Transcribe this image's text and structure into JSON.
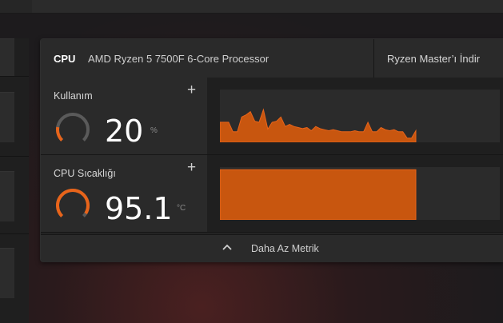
{
  "header": {
    "section": "CPU",
    "processor_name": "AMD Ryzen 5 7500F 6-Core Processor",
    "download_link": "Ryzen Master’ı İndir"
  },
  "metrics": [
    {
      "title": "Kullanım",
      "value": "20",
      "unit": "%",
      "gauge_fraction": 0.2,
      "add_label": "+",
      "history": [
        38,
        38,
        38,
        20,
        20,
        48,
        52,
        58,
        40,
        38,
        62,
        25,
        38,
        40,
        48,
        30,
        34,
        30,
        28,
        26,
        28,
        22,
        30,
        26,
        24,
        22,
        24,
        22,
        20,
        20,
        20,
        22,
        20,
        20,
        38,
        20,
        20,
        28,
        24,
        22,
        24,
        20,
        20,
        8,
        8,
        22
      ]
    },
    {
      "title": "CPU Sıcaklığı",
      "value": "95.1",
      "unit": "°C",
      "gauge_fraction": 0.95,
      "add_label": "+",
      "history": [
        95.1,
        95.1,
        95.1,
        95.1,
        95.1,
        95.1,
        95.1,
        95.1,
        95.1,
        95.1
      ]
    }
  ],
  "footer": {
    "label": "Daha Az Metrik"
  },
  "colors": {
    "accent": "#e8641a",
    "chart_fill": "#c8560f",
    "gauge_track": "#5a5a5a"
  },
  "icons": {
    "add": "plus-icon",
    "collapse": "chevron-up-icon"
  }
}
